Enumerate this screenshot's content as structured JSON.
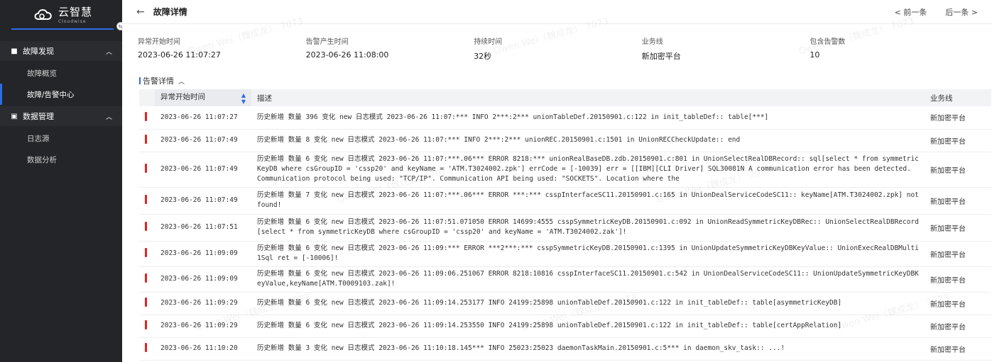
{
  "brand": {
    "name": "云智慧",
    "sub": "Cloudwise"
  },
  "sidebar": {
    "groups": [
      {
        "label": "故障发现",
        "items": [
          "故障概览",
          "故障/告警中心"
        ]
      },
      {
        "label": "数据管理",
        "items": [
          "日志源",
          "数据分析"
        ]
      }
    ]
  },
  "header": {
    "title": "故障详情",
    "prev": "< 前一条",
    "next": "后一条 >"
  },
  "meta": [
    {
      "label": "异常开始时间",
      "value": "2023-06-26 11:07:27"
    },
    {
      "label": "告警产生时间",
      "value": "2023-06-26 11:08:00"
    },
    {
      "label": "持续时间",
      "value": "32秒"
    },
    {
      "label": "业务线",
      "value": "新加密平台"
    },
    {
      "label": "包含告警数",
      "value": "10"
    }
  ],
  "section": {
    "title": "告警详情"
  },
  "table": {
    "headers": [
      "异常开始时间",
      "描述",
      "业务线"
    ],
    "rows": [
      {
        "time": "2023-06-26 11:07:27",
        "desc": "历史新增 数量 396 变化 new 日志模式 2023-06-26 11:07:*** INFO  2***:2*** unionTableDef.20150901.c:122 in init_tableDef:: table[***]",
        "biz": "新加密平台"
      },
      {
        "time": "2023-06-26 11:07:49",
        "desc": "历史新增 数量 8 变化 new 日志模式 2023-06-26 11:07:*** INFO  2***:2*** unionREC.20150901.c:1501 in UnionRECCheckUpdate:: end",
        "biz": "新加密平台"
      },
      {
        "time": "2023-06-26 11:07:49",
        "desc": "历史新增 数量 6 变化 new 日志模式 2023-06-26 11:07:***.06*** ERROR 8218:*** unionRealBaseDB.zdb.20150901.c:801 in UnionSelectRealDBRecord:: sql[select * from symmetricKeyDB where csGroupID = 'cssp20' and keyName = 'ATM.T3024002.zpk'] errCode = [-10039] err = [[IBM][CLI Driver] SQL30081N  A communication error has been detected. Communication protocol being used: \"TCP/IP\".  Communication API being used: \"SOCKETS\".  Location where the",
        "biz": "新加密平台"
      },
      {
        "time": "2023-06-26 11:07:49",
        "desc": "历史新增 数量 7 变化 new 日志模式 2023-06-26 11:07:***.06*** ERROR ***:*** csspInterfaceSC11.20150901.c:165 in UnionDealServiceCodeSC11:: keyName[ATM.T3024002.zpk] not found!",
        "biz": "新加密平台"
      },
      {
        "time": "2023-06-26 11:07:51",
        "desc": "历史新增 数量 6 变化 new 日志模式 2023-06-26 11:07:51.071050 ERROR 14699:4555 csspSymmetricKeyDB.20150901.c:092 in UnionReadSymmetricKeyDBRec:: UnionSelectRealDBRecord[select * from symmetricKeyDB where csGroupID = 'cssp20' and keyName = 'ATM.T3024002.zak']!",
        "biz": "新加密平台"
      },
      {
        "time": "2023-06-26 11:09:09",
        "desc": "历史新增 数量 6 变化 new 日志模式 2023-06-26 11:09:*** ERROR ***2***:*** csspSymmetricKeyDB.20150901.c:1395 in UnionUpdateSymmetricKeyDBKeyValue:: UnionExecRealDBMulti1Sql ret = [-10006]!",
        "biz": "新加密平台"
      },
      {
        "time": "2023-06-26 11:09:09",
        "desc": "历史新增 数量 6 变化 new 日志模式 2023-06-26 11:09:06.251067 ERROR 8218:10816 csspInterfaceSC11.20150901.c:542 in UnionDealServiceCodeSC11:: UnionUpdateSymmetricKeyDBKeyValue,keyName[ATM.T0009103.zak]!",
        "biz": "新加密平台"
      },
      {
        "time": "2023-06-26 11:09:29",
        "desc": "历史新增 数量 6 变化 new 日志模式 2023-06-26 11:09:14.253177 INFO  24199:25898 unionTableDef.20150901.c:122 in init_tableDef:: table[asymmetricKeyDB]",
        "biz": "新加密平台"
      },
      {
        "time": "2023-06-26 11:09:29",
        "desc": "历史新增 数量 6 变化 new 日志模式 2023-06-26 11:09:14.253550 INFO  24199:25898 unionTableDef.20150901.c:122 in init_tableDef:: table[certAppRelation]",
        "biz": "新加密平台"
      },
      {
        "time": "2023-06-26 11:10:20",
        "desc": "历史新增 数量 3 变化 new 日志模式 2023-06-26 11:10:18.145*** INFO  25023:25023 daemonTaskMain.20150901.c:5*** in daemon_skv_task::  ...!",
        "biz": "新加密平台"
      }
    ]
  },
  "watermark": {
    "text": "Owen Wei（魏成龙） 7073"
  }
}
